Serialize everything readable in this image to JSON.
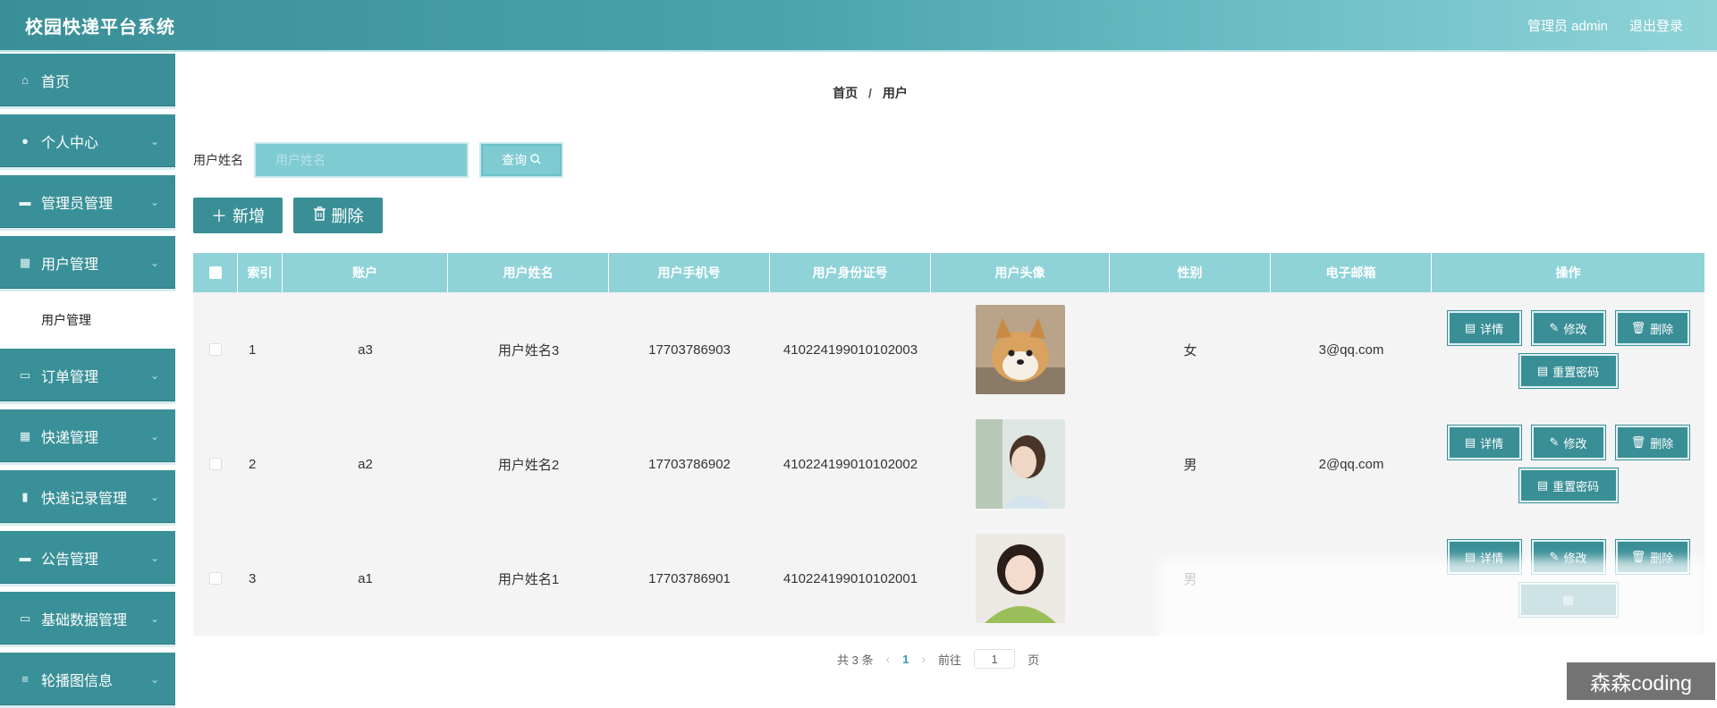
{
  "header": {
    "title": "校园快递平台系统",
    "user": "管理员 admin",
    "logout": "退出登录"
  },
  "sidebar": {
    "items": [
      {
        "label": "首页",
        "icon": "home-icon",
        "glyph": "⌂",
        "chevron": false
      },
      {
        "label": "个人中心",
        "icon": "person-icon",
        "glyph": "●",
        "chevron": true
      },
      {
        "label": "管理员管理",
        "icon": "chat-icon",
        "glyph": "▬",
        "chevron": true
      },
      {
        "label": "用户管理",
        "icon": "grid-icon",
        "glyph": "▦",
        "chevron": true
      },
      {
        "label": "订单管理",
        "icon": "briefcase-icon",
        "glyph": "▭",
        "chevron": true
      },
      {
        "label": "快递管理",
        "icon": "grid-icon",
        "glyph": "▦",
        "chevron": true
      },
      {
        "label": "快递记录管理",
        "icon": "clipboard-icon",
        "glyph": "▮",
        "chevron": true
      },
      {
        "label": "公告管理",
        "icon": "chat-icon",
        "glyph": "▬",
        "chevron": true
      },
      {
        "label": "基础数据管理",
        "icon": "ticket-icon",
        "glyph": "▭",
        "chevron": true
      },
      {
        "label": "轮播图信息",
        "icon": "sliders-icon",
        "glyph": "≡",
        "chevron": true
      }
    ],
    "sub_item": "用户管理"
  },
  "breadcrumb": {
    "home": "首页",
    "sep": "/",
    "current": "用户"
  },
  "search": {
    "label": "用户姓名",
    "placeholder": "用户姓名",
    "button": "查询"
  },
  "actions": {
    "add": "新增",
    "delete": "删除"
  },
  "table": {
    "headers": [
      "索引",
      "账户",
      "用户姓名",
      "用户手机号",
      "用户身份证号",
      "用户头像",
      "性别",
      "电子邮箱",
      "操作"
    ],
    "rows": [
      {
        "idx": "1",
        "account": "a3",
        "name": "用户姓名3",
        "phone": "17703786903",
        "id_card": "410224199010102003",
        "avatar": "shiba-dog-photo",
        "sex": "女",
        "email": "3@qq.com"
      },
      {
        "idx": "2",
        "account": "a2",
        "name": "用户姓名2",
        "phone": "17703786902",
        "id_card": "410224199010102002",
        "avatar": "girl-profile-photo",
        "sex": "男",
        "email": "2@qq.com"
      },
      {
        "idx": "3",
        "account": "a1",
        "name": "用户姓名1",
        "phone": "17703786901",
        "id_card": "410224199010102001",
        "avatar": "girl-green-sweater-photo",
        "sex": "男",
        "email": ""
      }
    ],
    "ops": {
      "detail": "详情",
      "edit": "修改",
      "delete": "删除",
      "reset": "重置密码"
    }
  },
  "pagination": {
    "total": "共 3 条",
    "page": "1",
    "goto": "前往",
    "goto_value": "1",
    "page_suffix": "页"
  },
  "watermark": "森森coding",
  "colors": {
    "primary": "#3a8f97",
    "header_light": "#8fd3d8",
    "table_bg": "#f4f4f5"
  }
}
